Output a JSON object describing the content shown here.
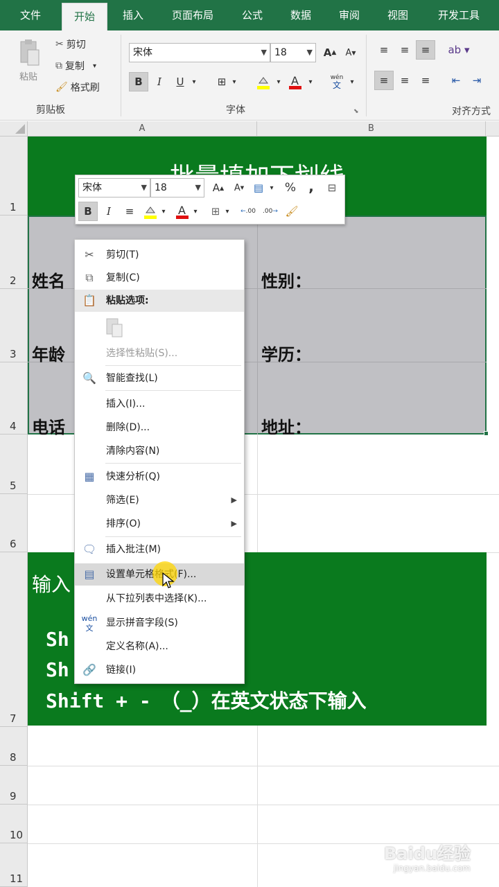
{
  "ribbon": {
    "tabs": [
      "文件",
      "开始",
      "插入",
      "页面布局",
      "公式",
      "数据",
      "审阅",
      "视图",
      "开发工具"
    ],
    "active_tab": "开始",
    "clipboard": {
      "paste": "粘贴",
      "cut": "剪切",
      "copy": "复制",
      "format_painter": "格式刷",
      "group": "剪贴板"
    },
    "font": {
      "name": "宋体",
      "size": "18",
      "group": "字体",
      "bold": "B",
      "italic": "I",
      "underline": "U",
      "grow": "A",
      "shrink": "A",
      "pinyin": "wén"
    },
    "align": {
      "group": "对齐方式"
    }
  },
  "sheet": {
    "columns": [
      "A",
      "B"
    ],
    "rows": [
      "1",
      "2",
      "3",
      "4",
      "5",
      "6",
      "7",
      "8",
      "9",
      "10",
      "11"
    ],
    "title": "批量填加下划线",
    "r2": {
      "a": "姓名",
      "b": "性别："
    },
    "r3": {
      "a": "年龄",
      "b": "学历："
    },
    "r4": {
      "a": "电话",
      "b": "地址："
    },
    "r7": {
      "line1": "输入",
      "line2": "Sh",
      "line3": "Sh",
      "line4": "Shift + -　（_）在英文状态下输入"
    }
  },
  "mini_toolbar": {
    "font": "宋体",
    "size": "18",
    "percent": "%",
    "comma": ",",
    "bold": "B",
    "italic": "I",
    "inc_decimal": ".00",
    "dec_decimal": ".00"
  },
  "context_menu": {
    "items": [
      {
        "label": "剪切(T)"
      },
      {
        "label": "复制(C)"
      },
      {
        "label": "粘贴选项:"
      },
      {
        "label": "选择性粘贴(S)..."
      },
      {
        "label": "智能查找(L)"
      },
      {
        "label": "插入(I)..."
      },
      {
        "label": "删除(D)..."
      },
      {
        "label": "清除内容(N)"
      },
      {
        "label": "快速分析(Q)"
      },
      {
        "label": "筛选(E)"
      },
      {
        "label": "排序(O)"
      },
      {
        "label": "插入批注(M)"
      },
      {
        "label": "设置单元格格式(F)..."
      },
      {
        "label": "从下拉列表中选择(K)..."
      },
      {
        "label": "显示拼音字段(S)"
      },
      {
        "label": "定义名称(A)..."
      },
      {
        "label": "链接(I)"
      }
    ]
  },
  "watermark": {
    "brand": "Baidu经验",
    "url": "jingyan.baidu.com"
  },
  "colors": {
    "brand_green": "#217346",
    "cell_green": "#0a7a1e",
    "selection_gray": "#c0c0c4"
  }
}
